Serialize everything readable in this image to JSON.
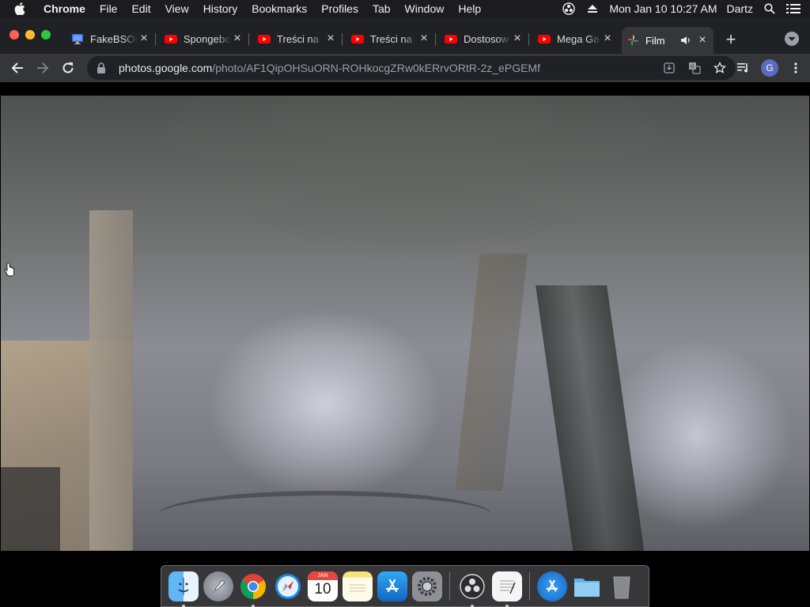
{
  "menubar": {
    "app": "Chrome",
    "items": [
      "File",
      "Edit",
      "View",
      "History",
      "Bookmarks",
      "Profiles",
      "Tab",
      "Window",
      "Help"
    ],
    "datetime": "Mon Jan 10  10:27 AM",
    "user": "Dartz"
  },
  "tabs": [
    {
      "title": "FakeBSOD",
      "icon": "monitor-icon"
    },
    {
      "title": "Spongebob",
      "icon": "youtube-icon"
    },
    {
      "title": "Treści na",
      "icon": "youtube-icon"
    },
    {
      "title": "Treści na",
      "icon": "youtube-icon"
    },
    {
      "title": "Dostosow",
      "icon": "youtube-icon"
    },
    {
      "title": "Mega Ga",
      "icon": "youtube-icon"
    },
    {
      "title": "Film",
      "icon": "google-photos-icon",
      "active": true,
      "audio": true
    }
  ],
  "toolbar": {
    "url_host": "photos.google.com",
    "url_path": "/photo/AF1QipOHSuORN-ROHkocgZRw0kERrvORtR-2z_ePGEMf",
    "profile_initial": "G"
  },
  "dock": {
    "calendar_month": "JAN",
    "calendar_day": "10",
    "apps": [
      "finder-icon",
      "launchpad-icon",
      "chrome-icon",
      "safari-icon",
      "calendar-icon",
      "notes-icon",
      "app-store-icon",
      "system-preferences-icon",
      "obs-icon",
      "textedit-icon",
      "app-store-download-icon",
      "folder-icon",
      "trash-icon"
    ]
  },
  "colors": {
    "menubar_bg": "#1c1c1e",
    "tabstrip_bg": "#202124",
    "toolbar_bg": "#35363a",
    "youtube_red": "#ff0000"
  }
}
